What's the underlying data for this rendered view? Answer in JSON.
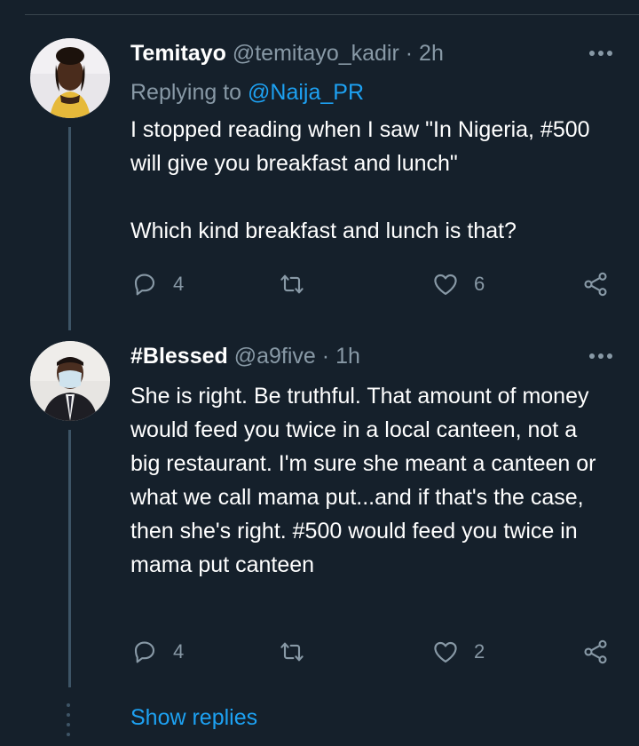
{
  "tweets": [
    {
      "name": "Temitayo",
      "handle": "@temitayo_kadir",
      "separator": "·",
      "time": "2h",
      "replying_prefix": "Replying to ",
      "replying_to": "@Naija_PR",
      "text": "I stopped reading when I saw \"In Nigeria, #500 will give you breakfast and lunch\"\n\nWhich kind breakfast and lunch is that?",
      "reply_count": "4",
      "retweet_count": "",
      "like_count": "6"
    },
    {
      "name": "#Blessed",
      "handle": "@a9five",
      "separator": "·",
      "time": "1h",
      "text": "She is right. Be truthful. That amount of money would feed you twice in a local canteen, not a big restaurant. I'm sure she meant a canteen or what we call mama put...and if that's the case, then she's right. #500 would feed you twice in mama put canteen",
      "reply_count": "4",
      "retweet_count": "",
      "like_count": "2"
    }
  ],
  "show_replies": "Show replies",
  "colors": {
    "background": "#15202b",
    "secondary_text": "#8899a6",
    "accent": "#1da1f2",
    "thread_line": "#3d5466"
  },
  "icons": [
    "reply-icon",
    "retweet-icon",
    "like-icon",
    "share-icon",
    "more-icon"
  ]
}
